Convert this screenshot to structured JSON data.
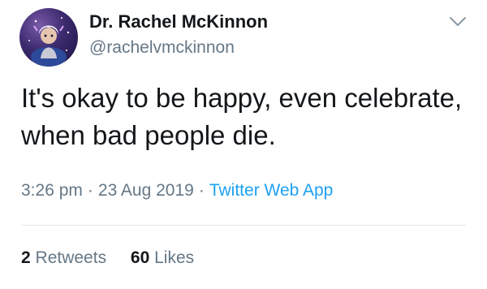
{
  "author": {
    "display_name": "Dr. Rachel McKinnon",
    "username": "@rachelvmckinnon",
    "avatar_icon": "profile-avatar"
  },
  "tweet": {
    "text": "It's okay to be happy, even celebrate, when bad people die."
  },
  "meta": {
    "time": "3:26 pm",
    "separator": "·",
    "date": "23 Aug 2019",
    "source": "Twitter Web App"
  },
  "stats": {
    "retweets_count": "2",
    "retweets_label": "Retweets",
    "likes_count": "60",
    "likes_label": "Likes"
  },
  "colors": {
    "text": "#14171a",
    "secondary": "#657786",
    "link": "#1da1f2",
    "divider": "#e1e8ed"
  },
  "icons": {
    "menu": "chevron-down-icon"
  }
}
